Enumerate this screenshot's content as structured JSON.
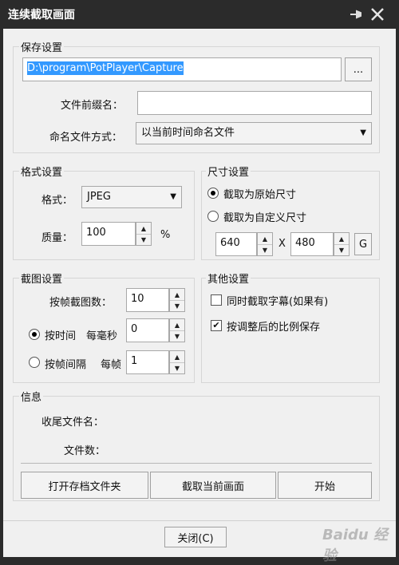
{
  "window": {
    "title": "连续截取画面"
  },
  "save": {
    "group_label": "保存设置",
    "path_value": "D:\\program\\PotPlayer\\Capture",
    "browse_label": "...",
    "prefix_label": "文件前缀名：",
    "prefix_value": "",
    "naming_label": "命名文件方式：",
    "naming_value": "以当前时间命名文件"
  },
  "format": {
    "group_label": "格式设置",
    "format_label": "格式：",
    "format_value": "JPEG",
    "quality_label": "质量：",
    "quality_value": "100",
    "quality_unit": "%"
  },
  "size": {
    "group_label": "尺寸设置",
    "original_label": "截取为原始尺寸",
    "custom_label": "截取为自定义尺寸",
    "width_value": "640",
    "times": "X",
    "height_value": "480",
    "g_label": "G"
  },
  "capture": {
    "group_label": "截图设置",
    "per_frame_label": "按帧截图数：",
    "per_frame_value": "10",
    "by_time_label": "按时间",
    "by_time_hint": "每毫秒",
    "by_time_value": "0",
    "by_frame_label": "按帧间隔",
    "by_frame_hint": "每帧",
    "by_frame_value": "1"
  },
  "other": {
    "group_label": "其他设置",
    "subs_label": "同时截取字幕(如果有)",
    "ratio_label": "按调整后的比例保存"
  },
  "info": {
    "group_label": "信息",
    "last_file_label": "收尾文件名：",
    "count_label": "文件数："
  },
  "actions": {
    "open_folder": "打开存档文件夹",
    "capture_now": "截取当前画面",
    "start": "开始",
    "close": "关闭(C)"
  },
  "watermark": {
    "text": "Baidu 经验"
  }
}
